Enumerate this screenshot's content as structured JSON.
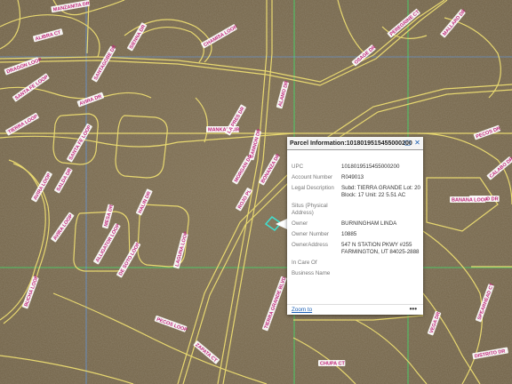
{
  "map": {
    "road_labels": [
      "MANZANITA DR",
      "ALIBRA CT",
      "DRAGON LOOP",
      "SANTA FE LOOP",
      "TIERRA LOOP",
      "CHAMISA LOOP",
      "SIENNA DR",
      "SANTA FE LOOP",
      "AVIRA DR",
      "SANTAGOBE DR",
      "AVIRA LOOP",
      "AVIRA LOOP",
      "MANKAR CIR",
      "CANNON DR",
      "MORGAN DR",
      "BUCHA LOOP",
      "DE SOTO LOOP",
      "HALIN DR",
      "SALDA DR",
      "ROJO PL",
      "ZAPATA CT",
      "PECOS LOOP",
      "LAGUNA LOOP",
      "LA PRES DR",
      "MESA DR",
      "ALLIGATOR LOOP",
      "TIERRA GRANDE BLVD",
      "ALAMO DR",
      "BONANZA DR",
      "CEDAR DR",
      "PECOS DR",
      "PEREGRINE CT",
      "CALABO DR",
      "DIABLO DR",
      "BANANA LOOP",
      "OSAGE DR",
      "SPEARHEAD CT",
      "DISTRITO DR",
      "VEGA DR",
      "CHUPA CT",
      "MALLARD DR"
    ]
  },
  "popup": {
    "title": "Parcel Information:1018019515455000200",
    "fields": [
      {
        "label": "UPC",
        "value": "1018019515455000200"
      },
      {
        "label": "Account Number",
        "value": "R049013"
      },
      {
        "label": "Legal Description",
        "value": "Subd: TIERRA GRANDE Lot: 20 Block: 17 Unit: 22 5.51 AC"
      },
      {
        "label": "Situs (Physical Address)",
        "value": ""
      },
      {
        "label": "Owner",
        "value": "BURNINGHAM LINDA"
      },
      {
        "label": "Owner Number",
        "value": "10885"
      },
      {
        "label": "OwnerAddress",
        "value": "547 N STATION PKWY #255 FARMINGTON, UT 84025-2888"
      },
      {
        "label": "In Care Of",
        "value": ""
      },
      {
        "label": "Business Name",
        "value": ""
      }
    ],
    "zoom_to": "Zoom to",
    "more": "•••"
  },
  "colors": {
    "terrain": "#7a6a4e",
    "road": "#e8d870",
    "label_text": "#c0267a",
    "grid_green": "#3ee06a",
    "selection": "#40e0d0",
    "link": "#1a5fb4"
  }
}
